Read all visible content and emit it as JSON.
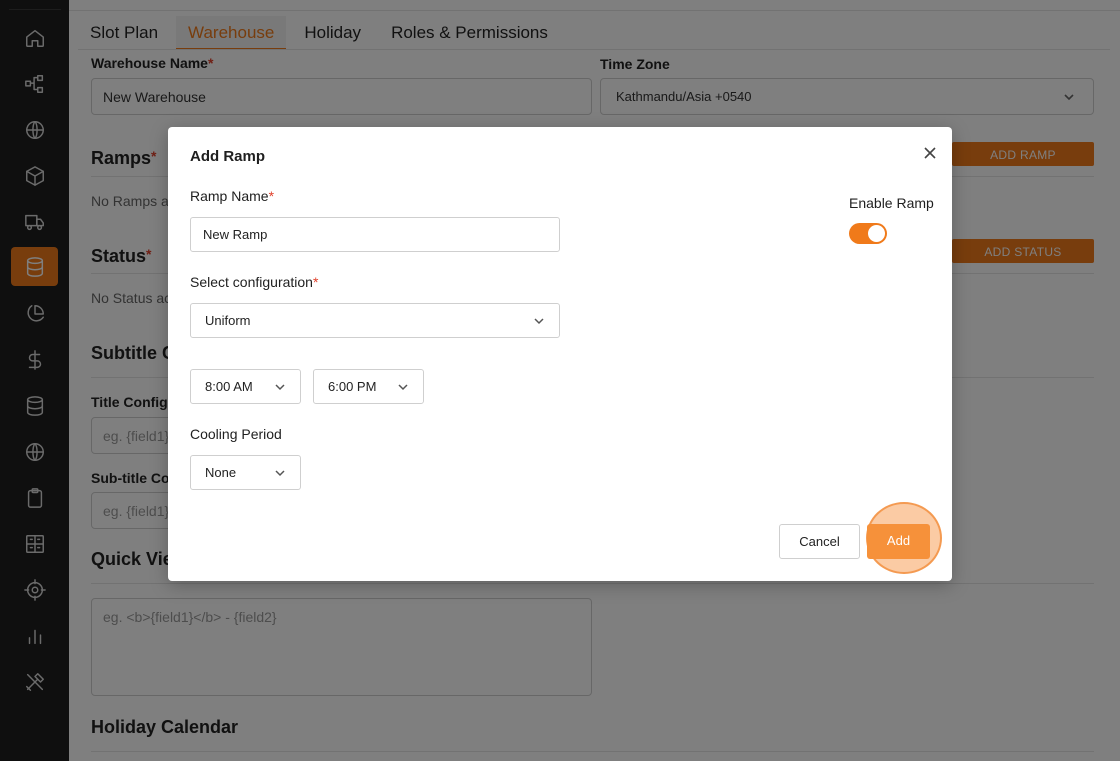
{
  "sidebar": {
    "items": [
      {
        "icon": "home-icon",
        "active": false
      },
      {
        "icon": "network-icon",
        "active": false
      },
      {
        "icon": "globe-icon",
        "active": false
      },
      {
        "icon": "cube-icon",
        "active": false
      },
      {
        "icon": "truck-icon",
        "active": false
      },
      {
        "icon": "database-icon",
        "active": true
      },
      {
        "icon": "pie-chart-icon",
        "active": false
      },
      {
        "icon": "dollar-icon",
        "active": false
      },
      {
        "icon": "database-icon",
        "active": false
      },
      {
        "icon": "globe-icon",
        "active": false
      },
      {
        "icon": "clipboard-icon",
        "active": false
      },
      {
        "icon": "grid-icon",
        "active": false
      },
      {
        "icon": "target-icon",
        "active": false
      },
      {
        "icon": "bar-chart-icon",
        "active": false
      },
      {
        "icon": "tools-icon",
        "active": false
      }
    ],
    "active_color": "#f07a1a"
  },
  "tabs": [
    {
      "label": "Slot Plan",
      "active": false
    },
    {
      "label": "Warehouse",
      "active": true
    },
    {
      "label": "Holiday",
      "active": false
    },
    {
      "label": "Roles & Permissions",
      "active": false
    }
  ],
  "form": {
    "warehouse_name_label": "Warehouse Name",
    "warehouse_name_value": "New Warehouse",
    "timezone_label": "Time Zone",
    "timezone_value": "Kathmandu/Asia +0540",
    "ramps_title": "Ramps",
    "ramps_empty": "No Ramps ac",
    "add_ramp_label": "ADD RAMP",
    "status_title": "Status",
    "status_empty": "No Status ac",
    "add_status_label": "ADD STATUS",
    "subtitle_config_title": "Subtitle C",
    "title_config_label": "Title Config",
    "title_config_placeholder": "eg. {field1}",
    "subtitle_config_label": "Sub-title Co",
    "subtitle_config_placeholder": "eg. {field1}",
    "quick_view_title": "Quick Vie",
    "quick_view_placeholder": "eg. <b>{field1}</b> - {field2}",
    "holiday_calendar_title": "Holiday Calendar",
    "required_mark": "*"
  },
  "modal": {
    "title": "Add Ramp",
    "ramp_name_label": "Ramp Name",
    "ramp_name_value": "New Ramp",
    "enable_ramp_label": "Enable Ramp",
    "enable_ramp_on": true,
    "config_label": "Select configuration",
    "config_value": "Uniform",
    "start_time": "8:00 AM",
    "end_time": "6:00 PM",
    "cooling_label": "Cooling Period",
    "cooling_value": "None",
    "cancel_label": "Cancel",
    "add_label": "Add",
    "required_mark": "*",
    "accent_color": "#f07a1a"
  }
}
